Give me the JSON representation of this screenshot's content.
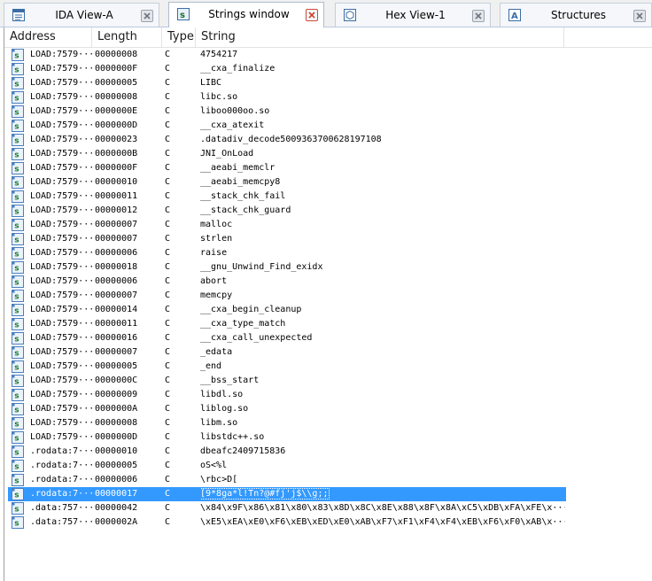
{
  "tabs": [
    {
      "label": "IDA View-A",
      "icon": "ida-view-icon",
      "active": false
    },
    {
      "label": "Strings window",
      "icon": "strings-icon",
      "active": true
    },
    {
      "label": "Hex View-1",
      "icon": "hex-icon",
      "active": false
    },
    {
      "label": "Structures",
      "icon": "structures-icon",
      "active": false
    }
  ],
  "table": {
    "columns": [
      "Address",
      "Length",
      "Type",
      "String"
    ],
    "selected_index": 31,
    "rows": [
      {
        "address": "LOAD:7579···",
        "length": "00000008",
        "type": "C",
        "string": "4754217"
      },
      {
        "address": "LOAD:7579···",
        "length": "0000000F",
        "type": "C",
        "string": "__cxa_finalize"
      },
      {
        "address": "LOAD:7579···",
        "length": "00000005",
        "type": "C",
        "string": "LIBC"
      },
      {
        "address": "LOAD:7579···",
        "length": "00000008",
        "type": "C",
        "string": "libc.so"
      },
      {
        "address": "LOAD:7579···",
        "length": "0000000E",
        "type": "C",
        "string": "liboo000oo.so"
      },
      {
        "address": "LOAD:7579···",
        "length": "0000000D",
        "type": "C",
        "string": "__cxa_atexit"
      },
      {
        "address": "LOAD:7579···",
        "length": "00000023",
        "type": "C",
        "string": ".datadiv_decode5009363700628197108"
      },
      {
        "address": "LOAD:7579···",
        "length": "0000000B",
        "type": "C",
        "string": "JNI_OnLoad"
      },
      {
        "address": "LOAD:7579···",
        "length": "0000000F",
        "type": "C",
        "string": "__aeabi_memclr"
      },
      {
        "address": "LOAD:7579···",
        "length": "00000010",
        "type": "C",
        "string": "__aeabi_memcpy8"
      },
      {
        "address": "LOAD:7579···",
        "length": "00000011",
        "type": "C",
        "string": "__stack_chk_fail"
      },
      {
        "address": "LOAD:7579···",
        "length": "00000012",
        "type": "C",
        "string": "__stack_chk_guard"
      },
      {
        "address": "LOAD:7579···",
        "length": "00000007",
        "type": "C",
        "string": "malloc"
      },
      {
        "address": "LOAD:7579···",
        "length": "00000007",
        "type": "C",
        "string": "strlen"
      },
      {
        "address": "LOAD:7579···",
        "length": "00000006",
        "type": "C",
        "string": "raise"
      },
      {
        "address": "LOAD:7579···",
        "length": "00000018",
        "type": "C",
        "string": "__gnu_Unwind_Find_exidx"
      },
      {
        "address": "LOAD:7579···",
        "length": "00000006",
        "type": "C",
        "string": "abort"
      },
      {
        "address": "LOAD:7579···",
        "length": "00000007",
        "type": "C",
        "string": "memcpy"
      },
      {
        "address": "LOAD:7579···",
        "length": "00000014",
        "type": "C",
        "string": "__cxa_begin_cleanup"
      },
      {
        "address": "LOAD:7579···",
        "length": "00000011",
        "type": "C",
        "string": "__cxa_type_match"
      },
      {
        "address": "LOAD:7579···",
        "length": "00000016",
        "type": "C",
        "string": "__cxa_call_unexpected"
      },
      {
        "address": "LOAD:7579···",
        "length": "00000007",
        "type": "C",
        "string": "_edata"
      },
      {
        "address": "LOAD:7579···",
        "length": "00000005",
        "type": "C",
        "string": "_end"
      },
      {
        "address": "LOAD:7579···",
        "length": "0000000C",
        "type": "C",
        "string": "__bss_start"
      },
      {
        "address": "LOAD:7579···",
        "length": "00000009",
        "type": "C",
        "string": "libdl.so"
      },
      {
        "address": "LOAD:7579···",
        "length": "0000000A",
        "type": "C",
        "string": "liblog.so"
      },
      {
        "address": "LOAD:7579···",
        "length": "00000008",
        "type": "C",
        "string": "libm.so"
      },
      {
        "address": "LOAD:7579···",
        "length": "0000000D",
        "type": "C",
        "string": "libstdc++.so"
      },
      {
        "address": ".rodata:7···",
        "length": "00000010",
        "type": "C",
        "string": "dbeafc2409715836"
      },
      {
        "address": ".rodata:7···",
        "length": "00000005",
        "type": "C",
        "string": "oS<%l"
      },
      {
        "address": ".rodata:7···",
        "length": "00000006",
        "type": "C",
        "string": "\\rbc>D["
      },
      {
        "address": ".rodata:7···",
        "length": "00000017",
        "type": "C",
        "string": "[9*8ga*l!Tn?@#fj'j$\\\\g;;"
      },
      {
        "address": ".data:757···",
        "length": "00000042",
        "type": "C",
        "string": "\\x84\\x9F\\x86\\x81\\x80\\x83\\x8D\\x8C\\x8E\\x88\\x8F\\x8A\\xC5\\xDB\\xFA\\xFE\\x···"
      },
      {
        "address": ".data:757···",
        "length": "0000002A",
        "type": "C",
        "string": "\\xE5\\xEA\\xE0\\xF6\\xEB\\xED\\xE0\\xAB\\xF7\\xF1\\xF4\\xF4\\xEB\\xF6\\xF0\\xAB\\x···"
      }
    ]
  }
}
